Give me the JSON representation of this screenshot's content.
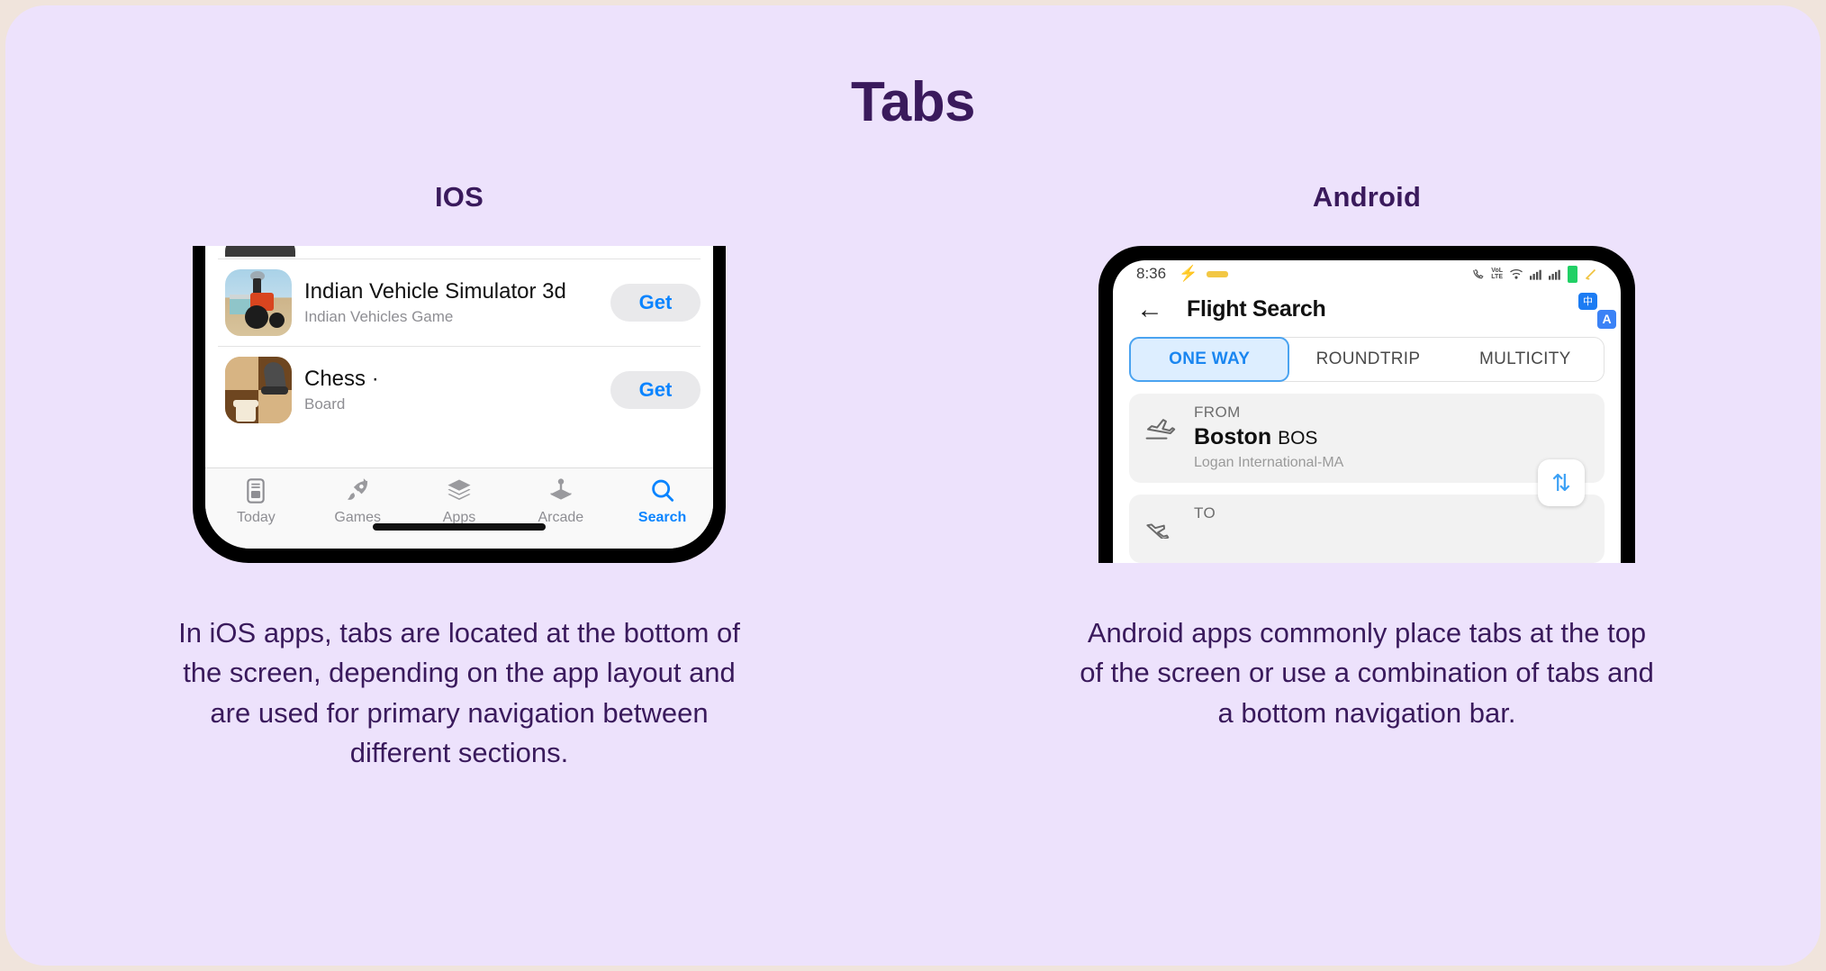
{
  "page": {
    "title": "Tabs",
    "background": "#ede2fc",
    "accent": "#3a1a5c"
  },
  "columns": [
    {
      "title": "IOS",
      "platform": "ios",
      "caption": "In iOS apps, tabs are located at the bottom of the screen, depending on the app layout and are used for primary navigation between different sections.",
      "app_store": {
        "rows": [
          {
            "name": "Indian Vehicle Simulator 3d",
            "subtitle": "Indian Vehicles Game",
            "action": "Get",
            "icon": "tractor-app-icon"
          },
          {
            "name": "Chess  ·",
            "subtitle": "Board",
            "action": "Get",
            "icon": "chess-app-icon"
          }
        ],
        "tabs": [
          {
            "label": "Today",
            "icon": "today-icon",
            "active": false
          },
          {
            "label": "Games",
            "icon": "rocket-icon",
            "active": false
          },
          {
            "label": "Apps",
            "icon": "stack-icon",
            "active": false
          },
          {
            "label": "Arcade",
            "icon": "joystick-icon",
            "active": false
          },
          {
            "label": "Search",
            "icon": "search-icon",
            "active": true
          }
        ],
        "active_tab_color": "#0a84ff",
        "inactive_tab_color": "#8e8e93"
      }
    },
    {
      "title": "Android",
      "platform": "android",
      "caption": "Android apps commonly place tabs at the top of the screen or use a combination of tabs and a bottom navigation bar.",
      "flight_app": {
        "status_bar": {
          "time": "8:36",
          "icons": [
            "bolt-icon",
            "notification-pill-icon",
            "call-icon",
            "volte-icon",
            "wifi-icon",
            "signal-icon",
            "signal-icon",
            "battery-icon",
            "edit-icon"
          ],
          "volte_label": "VoLTE"
        },
        "app_bar": {
          "back": "←",
          "title": "Flight Search",
          "action_icon": "translate-icon",
          "translate_letter": "A",
          "translate_glyph": "中"
        },
        "tabs": [
          {
            "label": "ONE WAY",
            "active": true
          },
          {
            "label": "ROUNDTRIP",
            "active": false
          },
          {
            "label": "MULTICITY",
            "active": false
          }
        ],
        "active_tab_color": "#1a86f0",
        "fields": [
          {
            "label": "FROM",
            "city": "Boston",
            "code": "BOS",
            "airport": "Logan International-MA",
            "icon": "takeoff-plane-icon"
          },
          {
            "label": "TO",
            "city": "",
            "code": "",
            "airport": "",
            "icon": "landing-plane-icon"
          }
        ],
        "swap_button": {
          "icon": "swap-vertical-icon",
          "glyph": "⇅"
        }
      }
    }
  ]
}
